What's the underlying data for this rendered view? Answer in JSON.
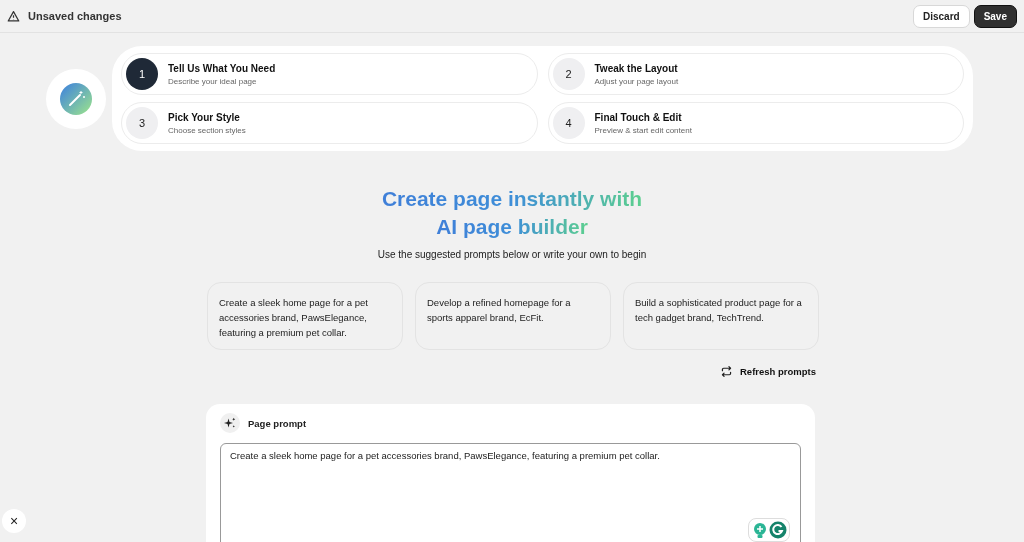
{
  "top_bar": {
    "status": "Unsaved changes",
    "buttons": [
      {
        "label": "Discard",
        "kind": "secondary"
      },
      {
        "label": "Save",
        "kind": "primary"
      }
    ]
  },
  "steps": [
    {
      "number": "1",
      "title": "Tell Us What You Need",
      "subtitle": "Describe your ideal page",
      "selected": true
    },
    {
      "number": "2",
      "title": "Tweak the Layout",
      "subtitle": "Adjust your page layout",
      "selected": false
    },
    {
      "number": "3",
      "title": "Pick Your Style",
      "subtitle": "Choose section styles",
      "selected": false
    },
    {
      "number": "4",
      "title": "Final Touch & Edit",
      "subtitle": "Preview & start edit content",
      "selected": false
    }
  ],
  "heading": {
    "lines": [
      "Create page instantly with",
      "AI page builder"
    ],
    "subtitle": "Use the suggested prompts below or write your own to begin"
  },
  "suggested_prompts": [
    "Create a sleek home page for a pet accessories brand, PawsElegance, featuring a premium pet collar.",
    "Develop a refined homepage for a sports apparel brand, EcFit.",
    "Build a sophisticated product page for a tech gadget brand, TechTrend."
  ],
  "refresh_label": "Refresh prompts",
  "page_prompt": {
    "title": "Page prompt",
    "value": "Create a sleek home page for a pet accessories brand, PawsElegance, featuring a premium pet collar."
  },
  "close_label": "×"
}
